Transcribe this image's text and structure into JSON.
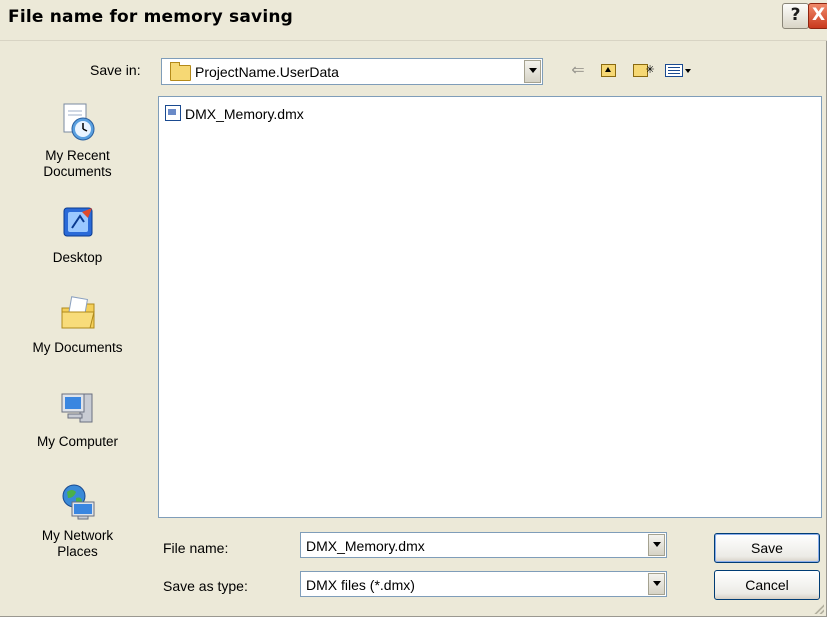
{
  "window": {
    "title": "File name for memory saving",
    "help_label": "?",
    "close_label": "X"
  },
  "save_in": {
    "label": "Save in:",
    "value": "ProjectName.UserData"
  },
  "toolbar": {
    "back_icon": "back-arrow-icon",
    "up_icon": "up-one-level-icon",
    "new_folder_icon": "new-folder-icon",
    "view_menu_icon": "view-menu-icon"
  },
  "places": [
    {
      "label": "My Recent\nDocuments",
      "icon": "recent-documents-icon"
    },
    {
      "label": "Desktop",
      "icon": "desktop-icon"
    },
    {
      "label": "My Documents",
      "icon": "my-documents-icon"
    },
    {
      "label": "My Computer",
      "icon": "my-computer-icon"
    },
    {
      "label": "My Network\nPlaces",
      "icon": "network-places-icon"
    }
  ],
  "files": [
    {
      "name": "DMX_Memory.dmx",
      "icon": "dmx-file-icon"
    }
  ],
  "form": {
    "file_name_label": "File name:",
    "file_name_value": "DMX_Memory.dmx",
    "save_type_label": "Save as type:",
    "save_type_value": "DMX files (*.dmx)"
  },
  "buttons": {
    "save": "Save",
    "cancel": "Cancel"
  }
}
